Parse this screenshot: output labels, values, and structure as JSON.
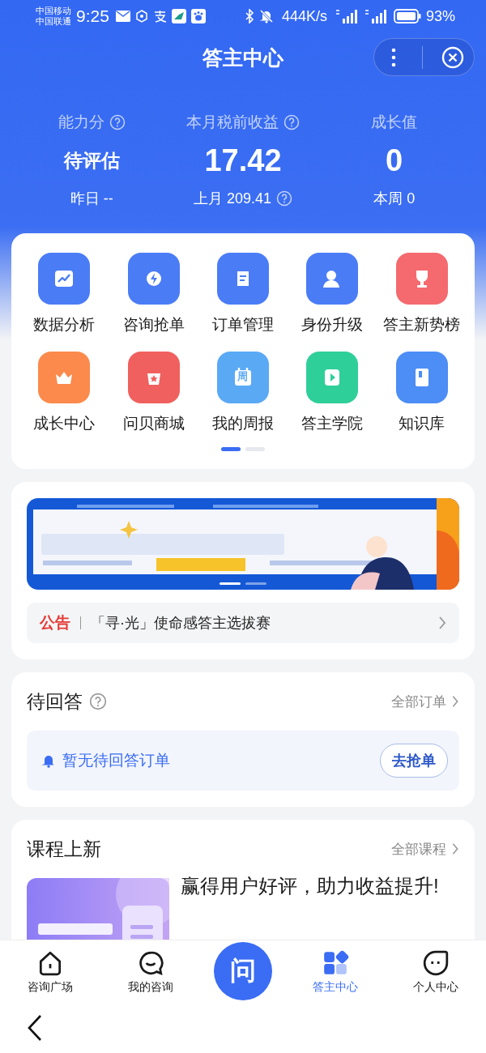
{
  "status_bar": {
    "carriers": [
      "中国移动",
      "中国联通"
    ],
    "time": "9:25",
    "speed": "444K/s",
    "battery": "93%"
  },
  "header": {
    "title": "答主中心"
  },
  "stats": [
    {
      "label": "能力分",
      "help": true,
      "value": "待评估",
      "sub": "昨日 --",
      "sub_help": false
    },
    {
      "label": "本月税前收益",
      "help": true,
      "value": "17.42",
      "sub": "上月 209.41",
      "sub_help": true
    },
    {
      "label": "成长值",
      "help": false,
      "value": "0",
      "sub": "本周 0",
      "sub_help": false
    }
  ],
  "tools": [
    {
      "label": "数据分析",
      "color": "#4a7cf6"
    },
    {
      "label": "咨询抢单",
      "color": "#4a7cf6"
    },
    {
      "label": "订单管理",
      "color": "#4a7cf6"
    },
    {
      "label": "身份升级",
      "color": "#4a7cf6"
    },
    {
      "label": "答主新势榜",
      "color": "#f46a6e"
    },
    {
      "label": "成长中心",
      "color": "#fb8a4c"
    },
    {
      "label": "问贝商城",
      "color": "#f0605e"
    },
    {
      "label": "我的周报",
      "color": "#5aa9f5",
      "glyph": "周"
    },
    {
      "label": "答主学院",
      "color": "#2fcf9a"
    },
    {
      "label": "知识库",
      "color": "#4c8df6"
    }
  ],
  "tool_pages": [
    {
      "selected": true
    },
    {
      "selected": false
    }
  ],
  "banner": {
    "kind": "picture",
    "dots": [
      {
        "selected": true
      },
      {
        "selected": false
      }
    ]
  },
  "notice": {
    "label": "公告",
    "text": "「寻·光」使命感答主选拔赛"
  },
  "pending": {
    "title": "待回答",
    "help": true,
    "link": "全部订单",
    "empty": "暂无待回答订单",
    "button": "去抢单"
  },
  "courses": {
    "title": "课程上新",
    "link": "全部课程",
    "items": [
      {
        "title": "赢得用户好评，助力收益提升!"
      }
    ]
  },
  "tabs": [
    {
      "kind": "tab",
      "label": "咨询广场",
      "selected": false
    },
    {
      "kind": "tab",
      "label": "我的咨询",
      "selected": false
    },
    {
      "kind": "center",
      "label": "问"
    },
    {
      "kind": "tab",
      "label": "答主中心",
      "selected": true
    },
    {
      "kind": "tab",
      "label": "个人中心",
      "selected": false
    }
  ]
}
